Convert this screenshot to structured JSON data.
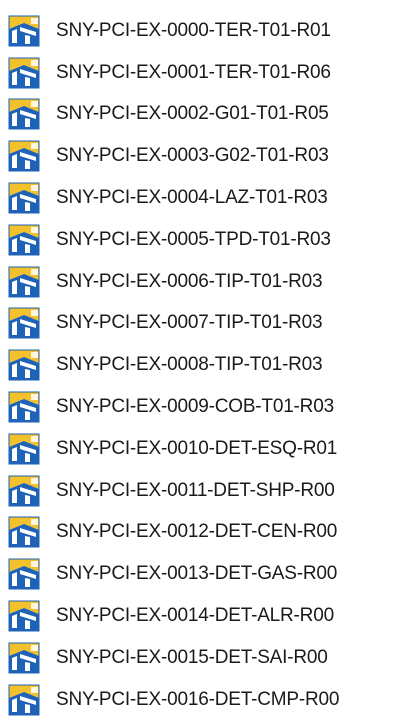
{
  "files": [
    {
      "name": "SNY-PCI-EX-0000-TER-T01-R01",
      "icon": "file-type-icon"
    },
    {
      "name": "SNY-PCI-EX-0001-TER-T01-R06",
      "icon": "file-type-icon"
    },
    {
      "name": "SNY-PCI-EX-0002-G01-T01-R05",
      "icon": "file-type-icon"
    },
    {
      "name": "SNY-PCI-EX-0003-G02-T01-R03",
      "icon": "file-type-icon"
    },
    {
      "name": "SNY-PCI-EX-0004-LAZ-T01-R03",
      "icon": "file-type-icon"
    },
    {
      "name": "SNY-PCI-EX-0005-TPD-T01-R03",
      "icon": "file-type-icon"
    },
    {
      "name": "SNY-PCI-EX-0006-TIP-T01-R03",
      "icon": "file-type-icon"
    },
    {
      "name": "SNY-PCI-EX-0007-TIP-T01-R03",
      "icon": "file-type-icon"
    },
    {
      "name": "SNY-PCI-EX-0008-TIP-T01-R03",
      "icon": "file-type-icon"
    },
    {
      "name": "SNY-PCI-EX-0009-COB-T01-R03",
      "icon": "file-type-icon"
    },
    {
      "name": "SNY-PCI-EX-0010-DET-ESQ-R01",
      "icon": "file-type-icon"
    },
    {
      "name": "SNY-PCI-EX-0011-DET-SHP-R00",
      "icon": "file-type-icon"
    },
    {
      "name": "SNY-PCI-EX-0012-DET-CEN-R00",
      "icon": "file-type-icon"
    },
    {
      "name": "SNY-PCI-EX-0013-DET-GAS-R00",
      "icon": "file-type-icon"
    },
    {
      "name": "SNY-PCI-EX-0014-DET-ALR-R00",
      "icon": "file-type-icon"
    },
    {
      "name": "SNY-PCI-EX-0015-DET-SAI-R00",
      "icon": "file-type-icon"
    },
    {
      "name": "SNY-PCI-EX-0016-DET-CMP-R00",
      "icon": "file-type-icon"
    }
  ],
  "colors": {
    "icon_blue": "#1e63b8",
    "icon_yellow": "#f3c22b",
    "icon_white": "#ffffff",
    "text": "#1a1a1a"
  }
}
